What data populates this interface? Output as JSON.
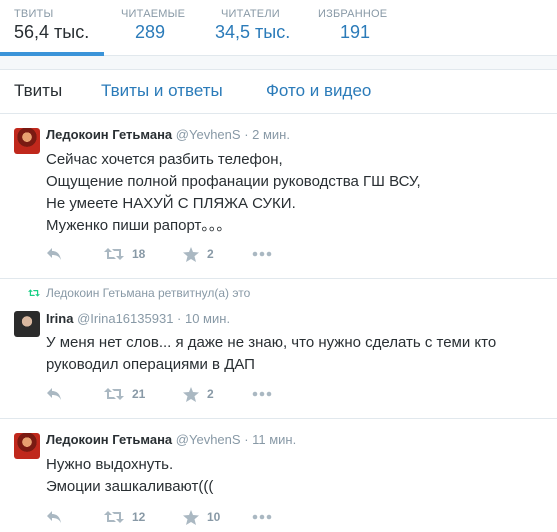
{
  "stats": [
    {
      "label": "ТВИТЫ",
      "value": "56,4 тыс."
    },
    {
      "label": "ЧИТАЕМЫЕ",
      "value": "289"
    },
    {
      "label": "ЧИТАТЕЛИ",
      "value": "34,5 тыс."
    },
    {
      "label": "ИЗБРАННОЕ",
      "value": "191"
    }
  ],
  "tabs": [
    {
      "label": "Твиты",
      "active": true
    },
    {
      "label": "Твиты и ответы",
      "active": false
    },
    {
      "label": "Фото и видео",
      "active": false
    }
  ],
  "tweets": [
    {
      "fullname": "Ледокоин Гетьмана",
      "username": "@YevhenS",
      "time": "· 2 мин.",
      "lines": [
        "Сейчас хочется разбить телефон,",
        "Ощущение полной профанации руководства ГШ ВСУ,",
        "Не умеете НАХУЙ С ПЛЯЖА СУКИ.",
        "Муженко пиши рапорт。。。"
      ],
      "retweets": "18",
      "favorites": "2"
    },
    {
      "context": "Ледокоин Гетьмана ретвитнул(а) это",
      "fullname": "Irina",
      "username": "@Irina16135931",
      "time": "· 10 мин.",
      "lines": [
        "У меня нет слов... я даже не знаю, что нужно сделать с теми кто",
        "руководил операциями в ДАП"
      ],
      "retweets": "21",
      "favorites": "2"
    },
    {
      "fullname": "Ледокоин Гетьмана",
      "username": "@YevhenS",
      "time": "· 11 мин.",
      "lines": [
        "Нужно выдохнуть.",
        "Эмоции зашкаливают((("
      ],
      "retweets": "12",
      "favorites": "10"
    }
  ],
  "icons": {
    "reply": "reply-icon",
    "retweet": "retweet-icon",
    "favorite": "star-icon",
    "more": "more-dots-icon"
  },
  "colors": {
    "link": "#2b7bb9",
    "accent": "#3b94d9",
    "muted": "#8899a6",
    "icon": "#aab8c2",
    "retweet_context": "#19cf86"
  }
}
